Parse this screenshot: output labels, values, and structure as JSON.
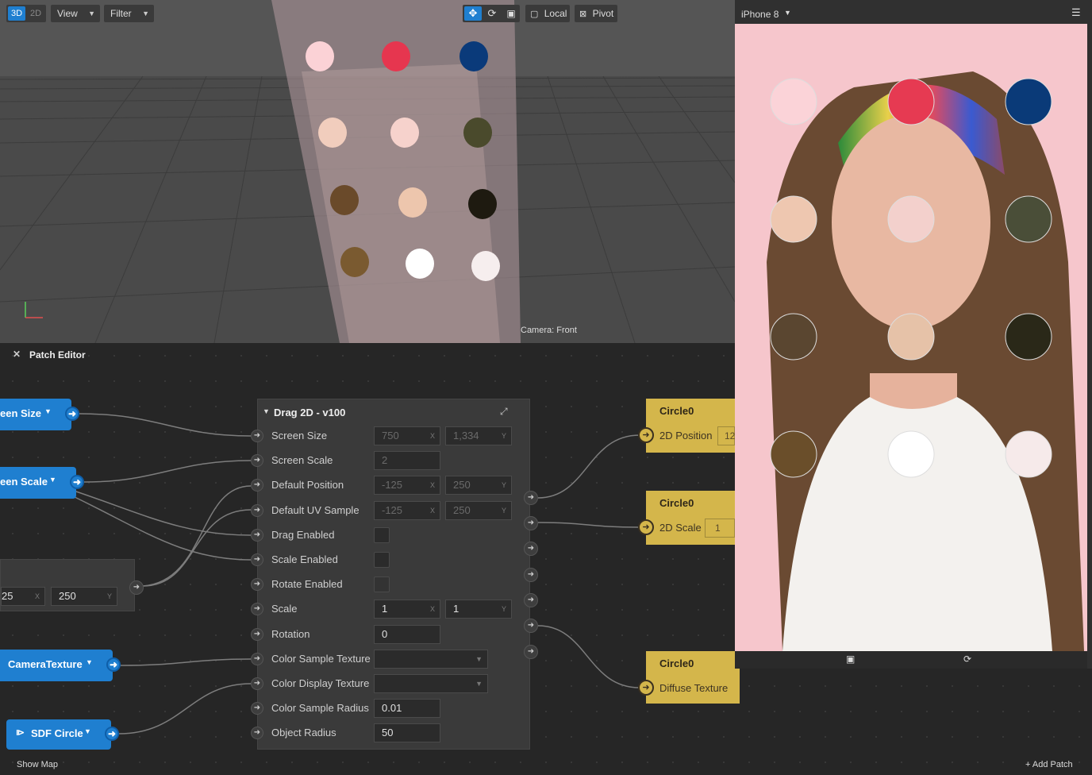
{
  "viewport": {
    "mode_3d": "3D",
    "mode_2d": "2D",
    "view_menu": "View",
    "filter_menu": "Filter",
    "local_label": "Local",
    "pivot_label": "Pivot",
    "camera_label": "Camera: Front",
    "swatches": [
      "#fbd2d6",
      "#e6364f",
      "#0a3a7a",
      "#f1cdbd",
      "#f6d2cc",
      "#4a4a2c",
      "#6a4a2a",
      "#edc6ad",
      "#1e1a10",
      "#7a5a30",
      "#ffffff",
      "#f6eeee"
    ]
  },
  "patch_editor": {
    "title": "Patch Editor",
    "left_nodes": {
      "screen_size": "een Size",
      "screen_scale": "een Scale",
      "camera_texture": "CameraTexture",
      "sdf_circle": "SDF Circle",
      "pack_x": "25",
      "pack_y": "250"
    },
    "drag_node": {
      "title": "Drag 2D - v100",
      "inputs": [
        {
          "label": "Screen Size",
          "x": "750",
          "y": "1,334"
        },
        {
          "label": "Screen Scale",
          "x": "2"
        },
        {
          "label": "Default Position",
          "x": "-125",
          "y": "250"
        },
        {
          "label": "Default UV Sample",
          "x": "-125",
          "y": "250"
        },
        {
          "label": "Drag Enabled"
        },
        {
          "label": "Scale Enabled"
        },
        {
          "label": "Rotate Enabled"
        },
        {
          "label": "Scale",
          "x": "1",
          "y": "1"
        },
        {
          "label": "Rotation",
          "x": "0"
        },
        {
          "label": "Color Sample Texture"
        },
        {
          "label": "Color Display Texture"
        },
        {
          "label": "Color Sample Radius",
          "x": "0.01"
        },
        {
          "label": "Object Radius",
          "x": "50"
        }
      ]
    },
    "circle_nodes": [
      {
        "title": "Circle0",
        "port": "2D Position",
        "value": "12"
      },
      {
        "title": "Circle0",
        "port": "2D Scale",
        "value": "1"
      },
      {
        "title": "Circle0",
        "port": "Diffuse Texture"
      }
    ],
    "show_map": "Show Map",
    "add_patch": "Add Patch"
  },
  "phone": {
    "device": "iPhone 8",
    "circles": [
      "#fbd3d8",
      "#e63a52",
      "#0a3a78",
      "#eec7b0",
      "#f3d0cc",
      "#4a4e38",
      "#5a4630",
      "#e6c2a8",
      "#2a2818",
      "#6a4e2a",
      "#ffffff",
      "#f6eaea"
    ]
  },
  "colors": {
    "accent": "#1f7fd0",
    "patch_yellow": "#d4b64b"
  }
}
